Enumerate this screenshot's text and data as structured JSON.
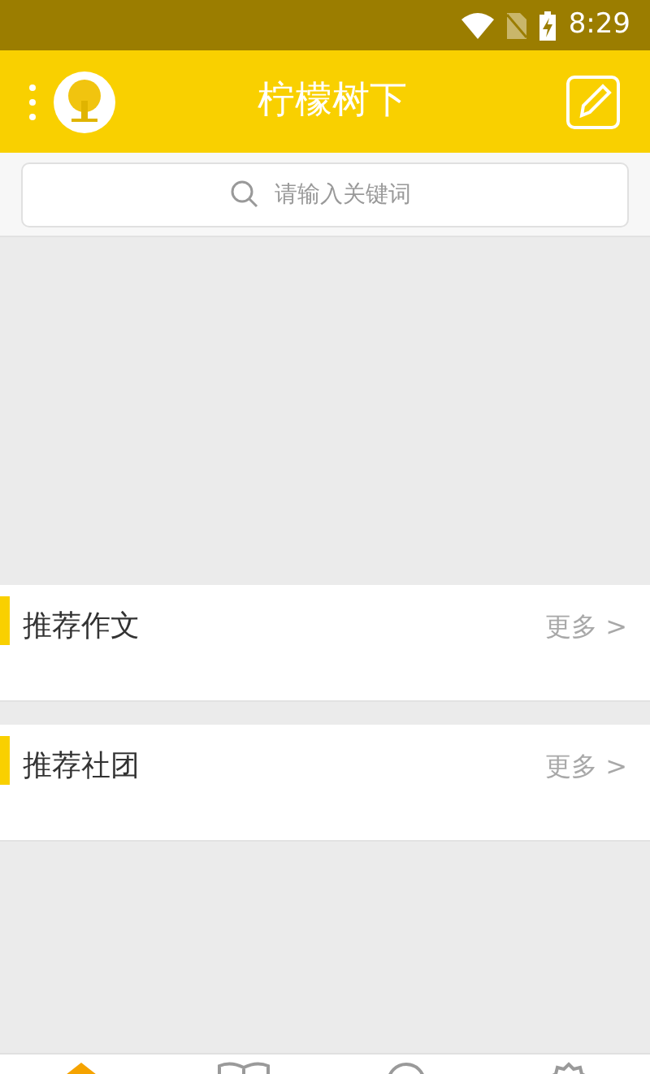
{
  "status_bar": {
    "time": "8:29"
  },
  "header": {
    "title": "柠檬树下"
  },
  "search": {
    "placeholder": "请输入关键词"
  },
  "sections": [
    {
      "title": "推荐作文",
      "more": "更多 >"
    },
    {
      "title": "推荐社团",
      "more": "更多 >"
    }
  ],
  "bottom_tabs": [
    {
      "kind": "home",
      "selected": true
    },
    {
      "kind": "book",
      "selected": false
    },
    {
      "kind": "circle",
      "selected": false
    },
    {
      "kind": "gear",
      "selected": false
    }
  ]
}
